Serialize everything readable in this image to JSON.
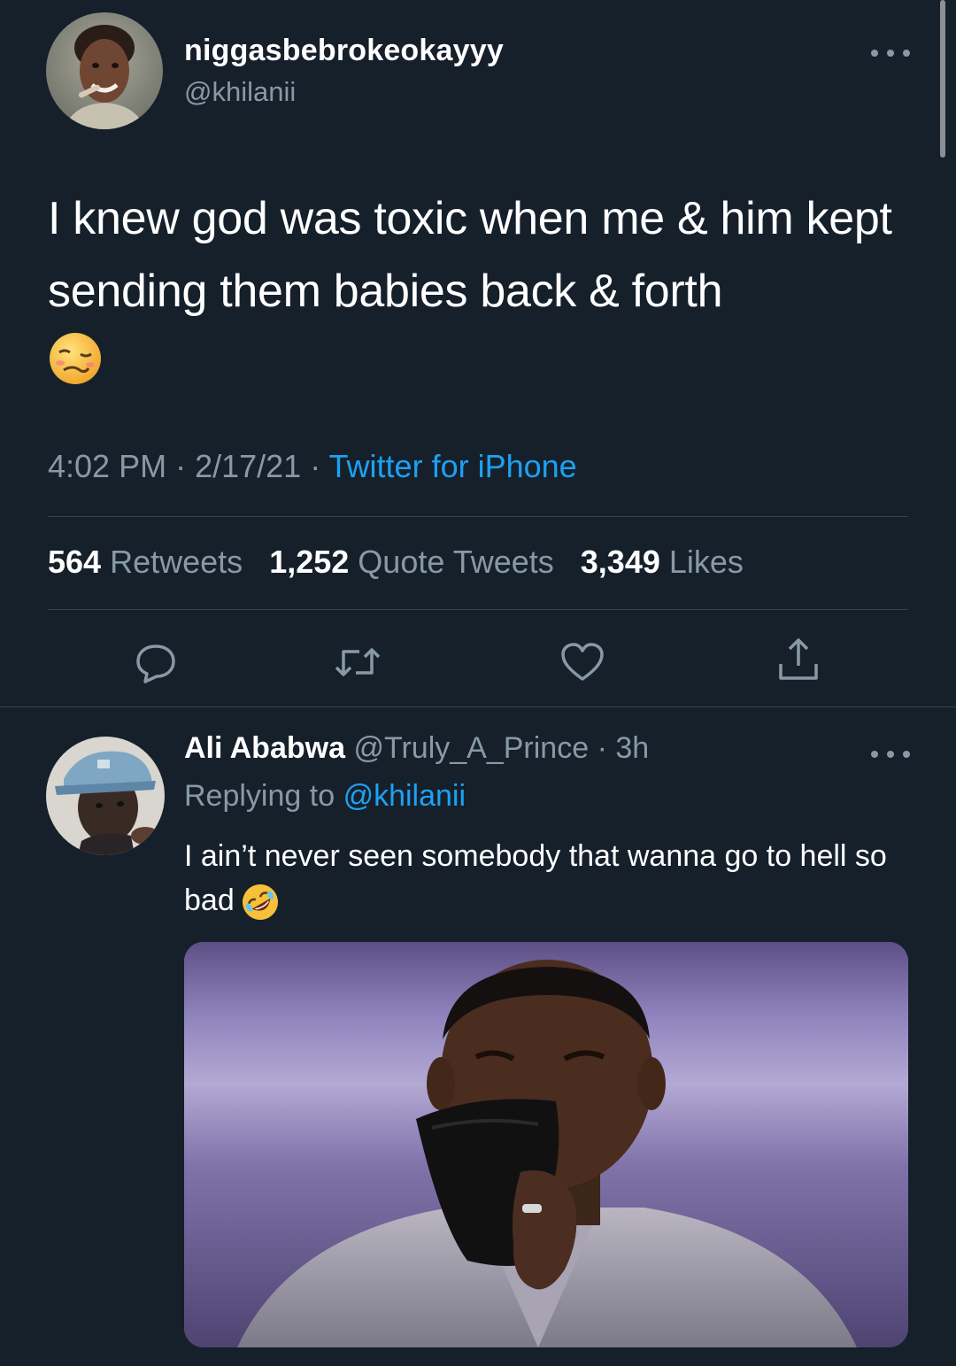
{
  "main_tweet": {
    "display_name": "niggasbebrokeokayyy",
    "handle": "@khilanii",
    "text": "I knew god was toxic when me & him kept sending them babies back & forth",
    "emoji": "woozy-face",
    "time": "4:02 PM",
    "date": "2/17/21",
    "source": "Twitter for iPhone",
    "stats": {
      "retweets_count": "564",
      "retweets_label": "Retweets",
      "quote_count": "1,252",
      "quote_label": "Quote Tweets",
      "likes_count": "3,349",
      "likes_label": "Likes"
    },
    "actions": [
      "reply-icon",
      "retweet-icon",
      "like-icon",
      "share-icon"
    ]
  },
  "reply": {
    "display_name": "Ali Ababwa",
    "handle": "@Truly_A_Prince",
    "time": "3h",
    "replying_prefix": "Replying to",
    "replying_to": "@khilanii",
    "text": "I ain’t never seen somebody that wanna go to hell so bad",
    "emoji": "rolling-on-floor-laughing",
    "media": "photo-man-laughing-holding-cloth"
  },
  "colors": {
    "background": "#15202b",
    "text": "#ffffff",
    "secondary": "#8899a6",
    "link": "#1da1f2",
    "divider": "#38444d"
  }
}
